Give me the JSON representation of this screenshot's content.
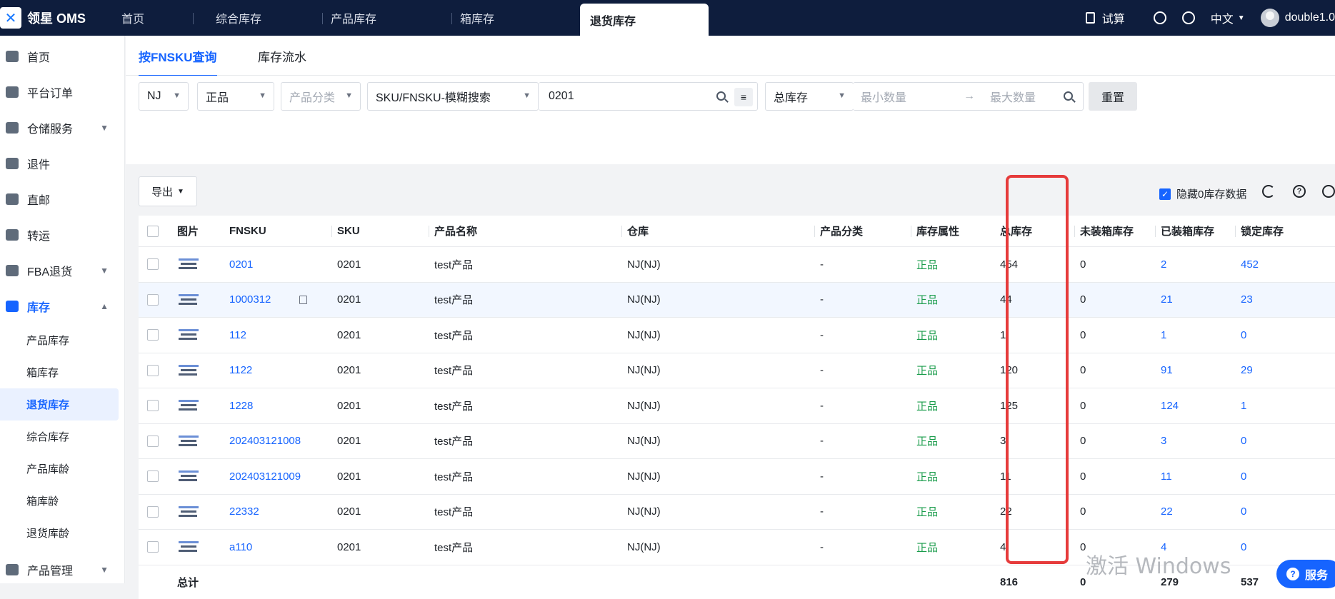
{
  "app": {
    "title": "领星 OMS"
  },
  "nav": {
    "tabs": [
      "首页",
      "综合库存",
      "产品库存",
      "箱库存",
      "退货库存"
    ],
    "active": "退货库存"
  },
  "top_right": {
    "calc": "试算",
    "lang": "中文",
    "user": "double1.0"
  },
  "sidebar": {
    "items": [
      {
        "label": "首页",
        "icon": "home-icon"
      },
      {
        "label": "平台订单",
        "icon": "order-icon"
      },
      {
        "label": "仓储服务",
        "icon": "warehouse-service-icon"
      },
      {
        "label": "退件",
        "icon": "return-icon"
      },
      {
        "label": "直邮",
        "icon": "direct-mail-icon"
      },
      {
        "label": "转运",
        "icon": "transfer-icon"
      },
      {
        "label": "FBA退货",
        "icon": "fba-return-icon"
      },
      {
        "label": "库存",
        "icon": "inventory-icon"
      }
    ],
    "inventory_sub": [
      "产品库存",
      "箱库存",
      "退货库存",
      "综合库存",
      "产品库龄",
      "箱库龄",
      "退货库龄"
    ],
    "active_sub": "退货库存",
    "bottom": {
      "label": "产品管理",
      "icon": "product-manage-icon"
    }
  },
  "subtabs": [
    "按FNSKU查询",
    "库存流水"
  ],
  "filters": {
    "warehouse": "NJ",
    "quality": "正品",
    "category_placeholder": "产品分类",
    "search_type": "SKU/FNSKU-模糊搜索",
    "search_value": "0201",
    "qty_type": "总库存",
    "min_placeholder": "最小数量",
    "max_placeholder": "最大数量",
    "reset": "重置"
  },
  "toolbar": {
    "export": "导出",
    "hide_zero": "隐藏0库存数据"
  },
  "table": {
    "headers": [
      "图片",
      "FNSKU",
      "SKU",
      "产品名称",
      "仓库",
      "产品分类",
      "库存属性",
      "总库存",
      "未装箱库存",
      "已装箱库存",
      "锁定库存"
    ],
    "rows": [
      {
        "fnsku": "0201",
        "sku": "0201",
        "name": "test产品",
        "wh": "NJ(NJ)",
        "cat": "-",
        "attr": "正品",
        "total": "454",
        "unboxed": "0",
        "boxed": "2",
        "locked": "452"
      },
      {
        "fnsku": "1000312",
        "sku": "0201",
        "name": "test产品",
        "wh": "NJ(NJ)",
        "cat": "-",
        "attr": "正品",
        "total": "44",
        "unboxed": "0",
        "boxed": "21",
        "locked": "23"
      },
      {
        "fnsku": "112",
        "sku": "0201",
        "name": "test产品",
        "wh": "NJ(NJ)",
        "cat": "-",
        "attr": "正品",
        "total": "1",
        "unboxed": "0",
        "boxed": "1",
        "locked": "0"
      },
      {
        "fnsku": "1122",
        "sku": "0201",
        "name": "test产品",
        "wh": "NJ(NJ)",
        "cat": "-",
        "attr": "正品",
        "total": "120",
        "unboxed": "0",
        "boxed": "91",
        "locked": "29"
      },
      {
        "fnsku": "1228",
        "sku": "0201",
        "name": "test产品",
        "wh": "NJ(NJ)",
        "cat": "-",
        "attr": "正品",
        "total": "125",
        "unboxed": "0",
        "boxed": "124",
        "locked": "1"
      },
      {
        "fnsku": "202403121008",
        "sku": "0201",
        "name": "test产品",
        "wh": "NJ(NJ)",
        "cat": "-",
        "attr": "正品",
        "total": "3",
        "unboxed": "0",
        "boxed": "3",
        "locked": "0"
      },
      {
        "fnsku": "202403121009",
        "sku": "0201",
        "name": "test产品",
        "wh": "NJ(NJ)",
        "cat": "-",
        "attr": "正品",
        "total": "11",
        "unboxed": "0",
        "boxed": "11",
        "locked": "0"
      },
      {
        "fnsku": "22332",
        "sku": "0201",
        "name": "test产品",
        "wh": "NJ(NJ)",
        "cat": "-",
        "attr": "正品",
        "total": "22",
        "unboxed": "0",
        "boxed": "22",
        "locked": "0"
      },
      {
        "fnsku": "a110",
        "sku": "0201",
        "name": "test产品",
        "wh": "NJ(NJ)",
        "cat": "-",
        "attr": "正品",
        "total": "4",
        "unboxed": "0",
        "boxed": "4",
        "locked": "0"
      }
    ],
    "total_row": {
      "label": "总计",
      "total": "816",
      "unboxed": "0",
      "boxed": "279",
      "locked": "537"
    }
  },
  "watermark": "激活 Windows",
  "service": "服务",
  "colors": {
    "accent": "#1664ff",
    "topbar": "#0e1d3d",
    "highlight_box": "#e63b3b",
    "green": "#1a9c4b"
  }
}
